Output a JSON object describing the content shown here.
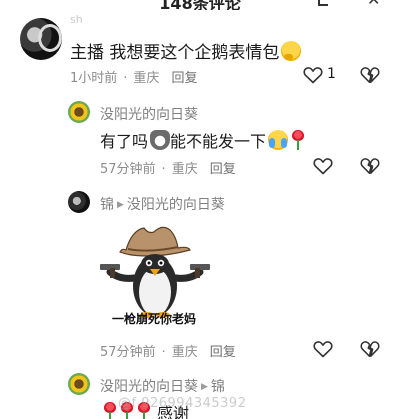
{
  "header": {
    "title": "148条评论"
  },
  "comments": [
    {
      "handle": "sh",
      "text": "主播 我想要这个企鹅表情包",
      "time": "1小时前",
      "location": "重庆",
      "reply_label": "回复",
      "like_count": "1"
    },
    {
      "name": "没阳光的向日葵",
      "text": "有了吗",
      "text2": "能不能发一下",
      "time": "57分钟前",
      "location": "重庆",
      "reply_label": "回复"
    },
    {
      "name": "锦",
      "reply_to": "没阳光的向日葵",
      "sticker_caption": "一枪崩死你老妈",
      "time": "57分钟前",
      "location": "重庆",
      "reply_label": "回复"
    },
    {
      "name": "没阳光的向日葵",
      "reply_to": "锦",
      "text": "感谢"
    }
  ],
  "watermark": "@f 926994345392",
  "icons": {
    "like": "heart-outline-icon",
    "dislike": "broken-heart-icon",
    "arrow": "play-arrow-icon"
  }
}
